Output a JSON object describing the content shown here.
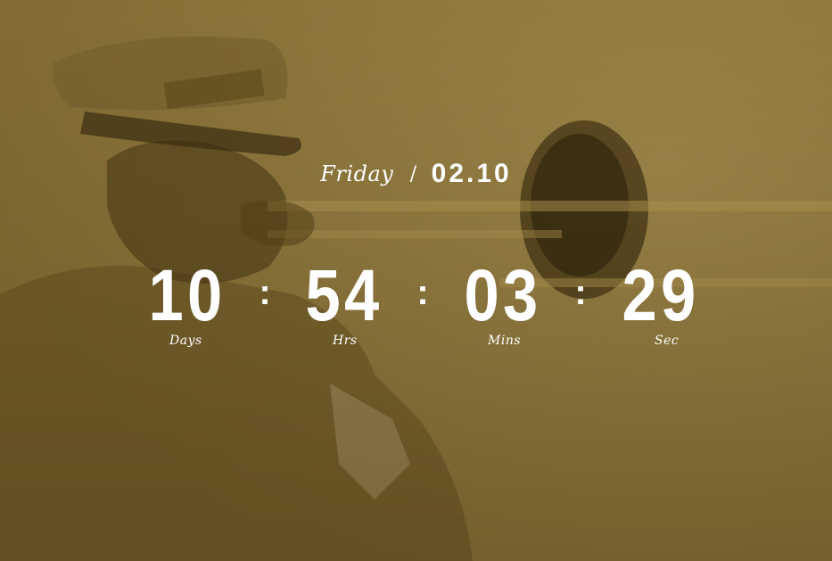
{
  "date": {
    "weekday": "Friday",
    "separator": "/",
    "date": "02.10"
  },
  "countdown": {
    "days": {
      "value": "10",
      "label": "Days"
    },
    "hours": {
      "value": "54",
      "label": "Hrs"
    },
    "minutes": {
      "value": "03",
      "label": "Mins"
    },
    "seconds": {
      "value": "29",
      "label": "Sec"
    },
    "separator": ":"
  },
  "theme": {
    "overlay_color": "#8a7236",
    "text_color": "#ffffff"
  }
}
